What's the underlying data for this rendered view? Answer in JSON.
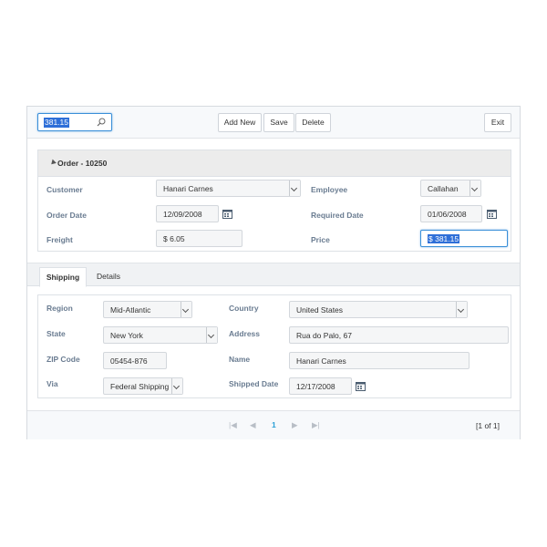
{
  "toolbar": {
    "search_value": "381.15",
    "add_new": "Add New",
    "save": "Save",
    "delete": "Delete",
    "exit": "Exit"
  },
  "order": {
    "title": "Order - 10250",
    "customer_label": "Customer",
    "customer_value": "Hanari Carnes",
    "employee_label": "Employee",
    "employee_value": "Callahan",
    "order_date_label": "Order Date",
    "order_date_value": "12/09/2008",
    "required_date_label": "Required Date",
    "required_date_value": "01/06/2008",
    "freight_label": "Freight",
    "freight_value": "$ 6.05",
    "price_label": "Price",
    "price_value": "$ 381.15"
  },
  "tabs": [
    "Shipping",
    "Details"
  ],
  "shipping": {
    "region_label": "Region",
    "region_value": "Mid-Atlantic",
    "country_label": "Country",
    "country_value": "United States",
    "state_label": "State",
    "state_value": "New York",
    "address_label": "Address",
    "address_value": "Rua do Palo, 67",
    "zip_label": "ZIP Code",
    "zip_value": "05454-876",
    "name_label": "Name",
    "name_value": "Hanari Carnes",
    "via_label": "Via",
    "via_value": "Federal Shipping",
    "shipped_date_label": "Shipped Date",
    "shipped_date_value": "12/17/2008"
  },
  "pager": {
    "current_page": "1",
    "info": "[1 of 1]"
  }
}
